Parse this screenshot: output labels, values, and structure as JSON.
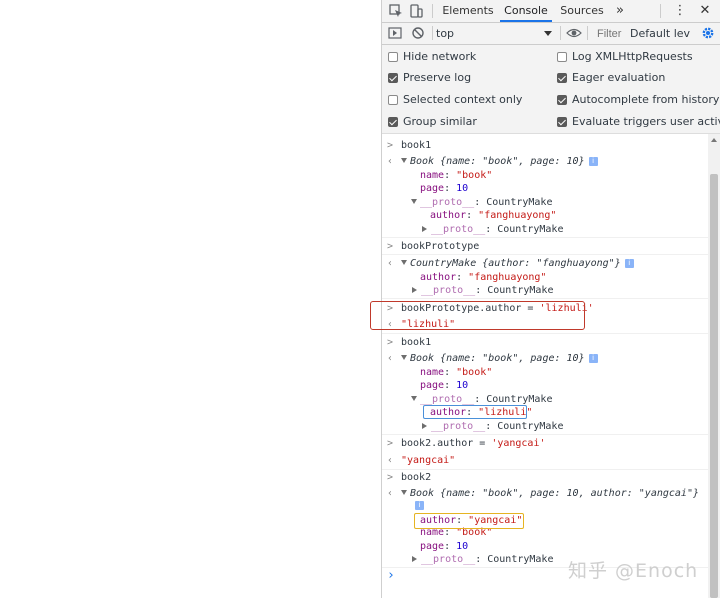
{
  "devtools": {
    "tabs": [
      "Elements",
      "Console",
      "Sources"
    ],
    "active_tab": "Console",
    "more_tabs": "»",
    "menu": "⋮",
    "close": "✕"
  },
  "toolbar": {
    "context": "top",
    "filter_placeholder": "Filter",
    "levels": "Default leve"
  },
  "settings": {
    "hide_network": {
      "label": "Hide network",
      "checked": false
    },
    "log_xhr": {
      "label": "Log XMLHttpRequests",
      "checked": false
    },
    "preserve_log": {
      "label": "Preserve log",
      "checked": true
    },
    "eager_eval": {
      "label": "Eager evaluation",
      "checked": true
    },
    "selected_context": {
      "label": "Selected context only",
      "checked": false
    },
    "autocomplete": {
      "label": "Autocomplete from history",
      "checked": true
    },
    "group_similar": {
      "label": "Group similar",
      "checked": true
    },
    "eval_triggers": {
      "label": "Evaluate triggers user activation",
      "checked": true
    }
  },
  "console": {
    "l1": "book1",
    "l2_obj": "Book {name: \"book\", page: 10}",
    "l3_key": "name",
    "l3_val": "\"book\"",
    "l4_key": "page",
    "l4_val": "10",
    "l5_key": "__proto__",
    "l5_val": "CountryMake",
    "l6_key": "author",
    "l6_val": "\"fanghuayong\"",
    "l7_key": "__proto__",
    "l7_val": "CountryMake",
    "l8": "bookPrototype",
    "l9_obj": "CountryMake {author: \"fanghuayong\"}",
    "l10_key": "author",
    "l10_val": "\"fanghuayong\"",
    "l11_key": "__proto__",
    "l11_val": "CountryMake",
    "l12_cmd": "bookPrototype.author = ",
    "l12_str": "'lizhuli'",
    "l13": "\"lizhuli\"",
    "l14": "book1",
    "l15_obj": "Book {name: \"book\", page: 10}",
    "l16_key": "name",
    "l16_val": "\"book\"",
    "l17_key": "page",
    "l17_val": "10",
    "l18_key": "__proto__",
    "l18_val": "CountryMake",
    "l19_key": "author",
    "l19_val": "\"lizhuli\"",
    "l20_key": "__proto__",
    "l20_val": "CountryMake",
    "l21_cmd": "book2.author = ",
    "l21_str": "'yangcai'",
    "l22": "\"yangcai\"",
    "l23": "book2",
    "l24_obj": "Book {name: \"book\", page: 10, author: \"yangcai\"}",
    "l25_key": "author",
    "l25_val": "\"yangcai\"",
    "l26_key": "name",
    "l26_val": "\"book\"",
    "l27_key": "page",
    "l27_val": "10",
    "l28_key": "__proto__",
    "l28_val": "CountryMake",
    "prompt": "›"
  },
  "watermark": "知乎 @Enoch",
  "colors": {
    "accent": "#1a73e8",
    "annotation_red": "#c0392b",
    "annotation_blue": "#4a90d9",
    "annotation_yellow": "#e6b422"
  }
}
